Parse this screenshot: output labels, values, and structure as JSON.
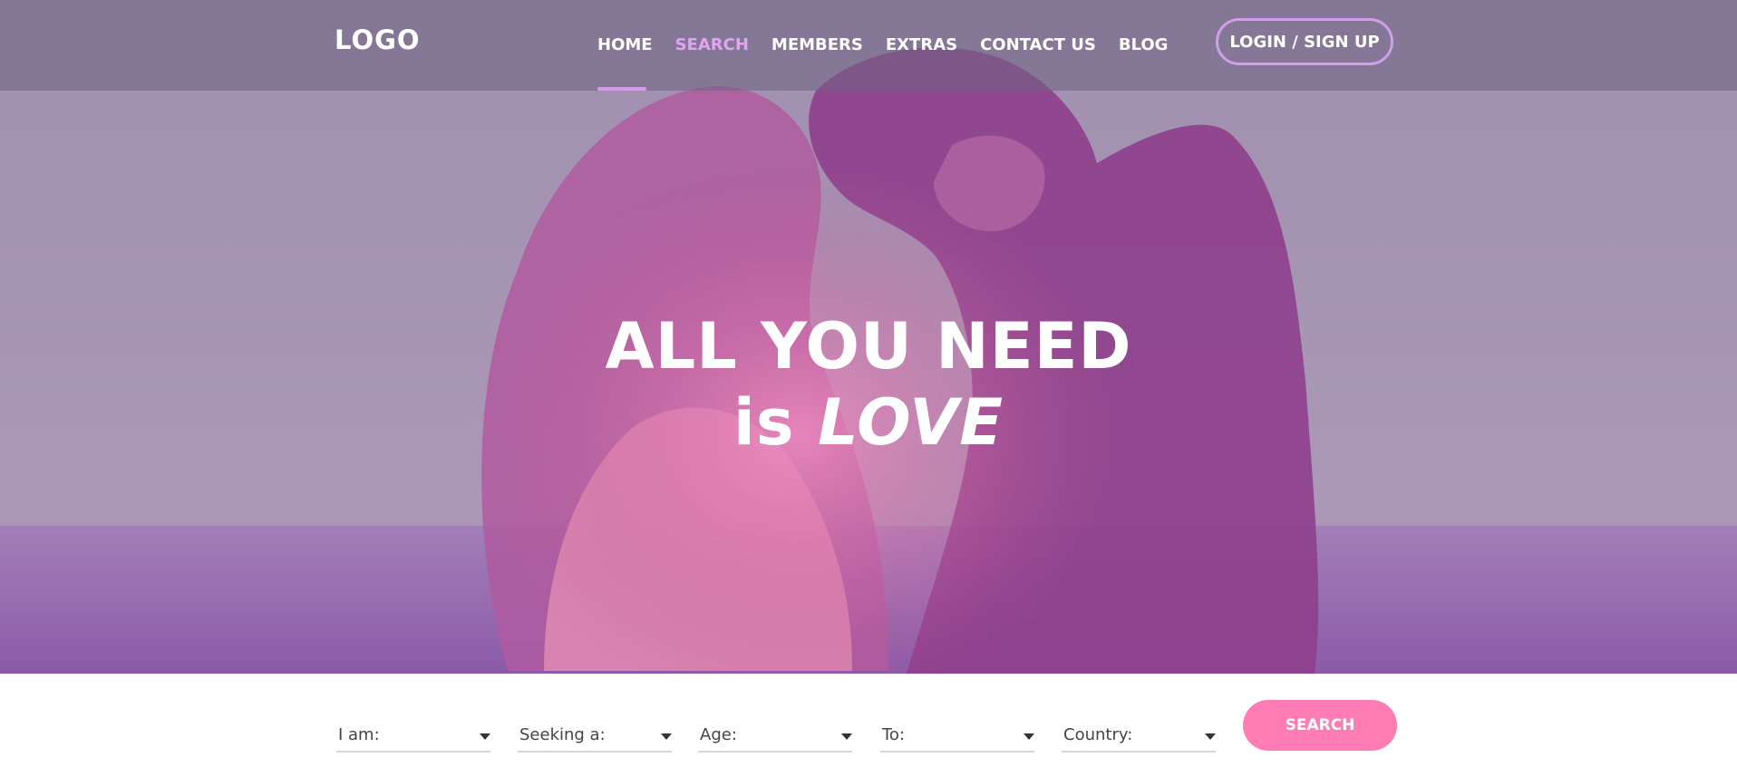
{
  "header": {
    "logo": "LOGO",
    "nav": [
      {
        "label": "HOME"
      },
      {
        "label": "SEARCH"
      },
      {
        "label": "MEMBERS"
      },
      {
        "label": "EXTRAS"
      },
      {
        "label": "CONTACT US"
      },
      {
        "label": "BLOG"
      }
    ],
    "login_label": "LOGIN / SIGN UP"
  },
  "hero": {
    "line1": "ALL YOU NEED",
    "line2_prefix": "is",
    "line2_emphasis": "LOVE"
  },
  "search": {
    "fields": [
      {
        "label": "I am:"
      },
      {
        "label": "Seeking a:"
      },
      {
        "label": "Age:"
      },
      {
        "label": "To:"
      },
      {
        "label": "Country:"
      }
    ],
    "button_label": "SEARCH"
  },
  "colors": {
    "accent_purple": "#d19be8",
    "active_nav": "#e2a3f0",
    "search_button": "#ff7cb4"
  }
}
